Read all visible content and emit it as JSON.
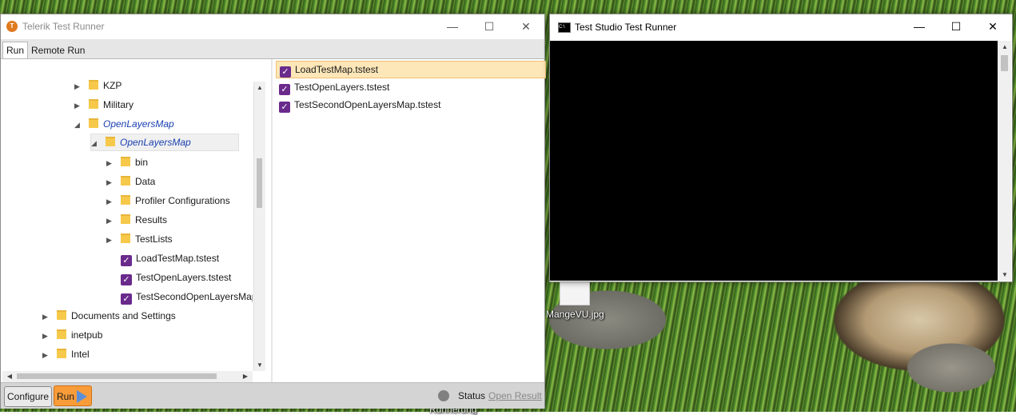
{
  "desktop": {
    "icon_label_1": "MangeVU.jpg",
    "icon_label_2": "Runnerung"
  },
  "main_window": {
    "title": "Telerik Test Runner",
    "app_icon_glyph": "T",
    "minimize": "—",
    "maximize": "☐",
    "close": "✕",
    "tabs": [
      {
        "label": "Run",
        "active": true
      },
      {
        "label": "Remote Run",
        "active": false
      }
    ],
    "tree": [
      {
        "label": "KZP"
      },
      {
        "label": "Military"
      },
      {
        "label": "OpenLayersMap"
      },
      {
        "label": "OpenLayersMap"
      },
      {
        "label": "bin"
      },
      {
        "label": "Data"
      },
      {
        "label": "Profiler Configurations"
      },
      {
        "label": "Results"
      },
      {
        "label": "TestLists"
      },
      {
        "label": "LoadTestMap.tstest"
      },
      {
        "label": "TestOpenLayers.tstest"
      },
      {
        "label": "TestSecondOpenLayersMap"
      },
      {
        "label": "Documents and Settings"
      },
      {
        "label": "inetpub"
      },
      {
        "label": "Intel"
      }
    ],
    "tests": [
      {
        "label": "LoadTestMap.tstest",
        "selected": true
      },
      {
        "label": "TestOpenLayers.tstest",
        "selected": false
      },
      {
        "label": "TestSecondOpenLayersMap.tstest",
        "selected": false
      }
    ],
    "bottom": {
      "configure_label": "Configure",
      "run_label": "Run",
      "status_label": "Status",
      "open_result_label": "Open Result"
    }
  },
  "console_window": {
    "title": "Test Studio Test Runner",
    "icon_glyph": "C:\\",
    "minimize": "—",
    "maximize": "☐",
    "close": "✕"
  },
  "colors": {
    "run_button": "#f89c3a",
    "selected_test": "#fde6b8",
    "tstest_icon": "#6a2a8c",
    "folder": "#f6c94a",
    "link": "#1a3fb0"
  }
}
